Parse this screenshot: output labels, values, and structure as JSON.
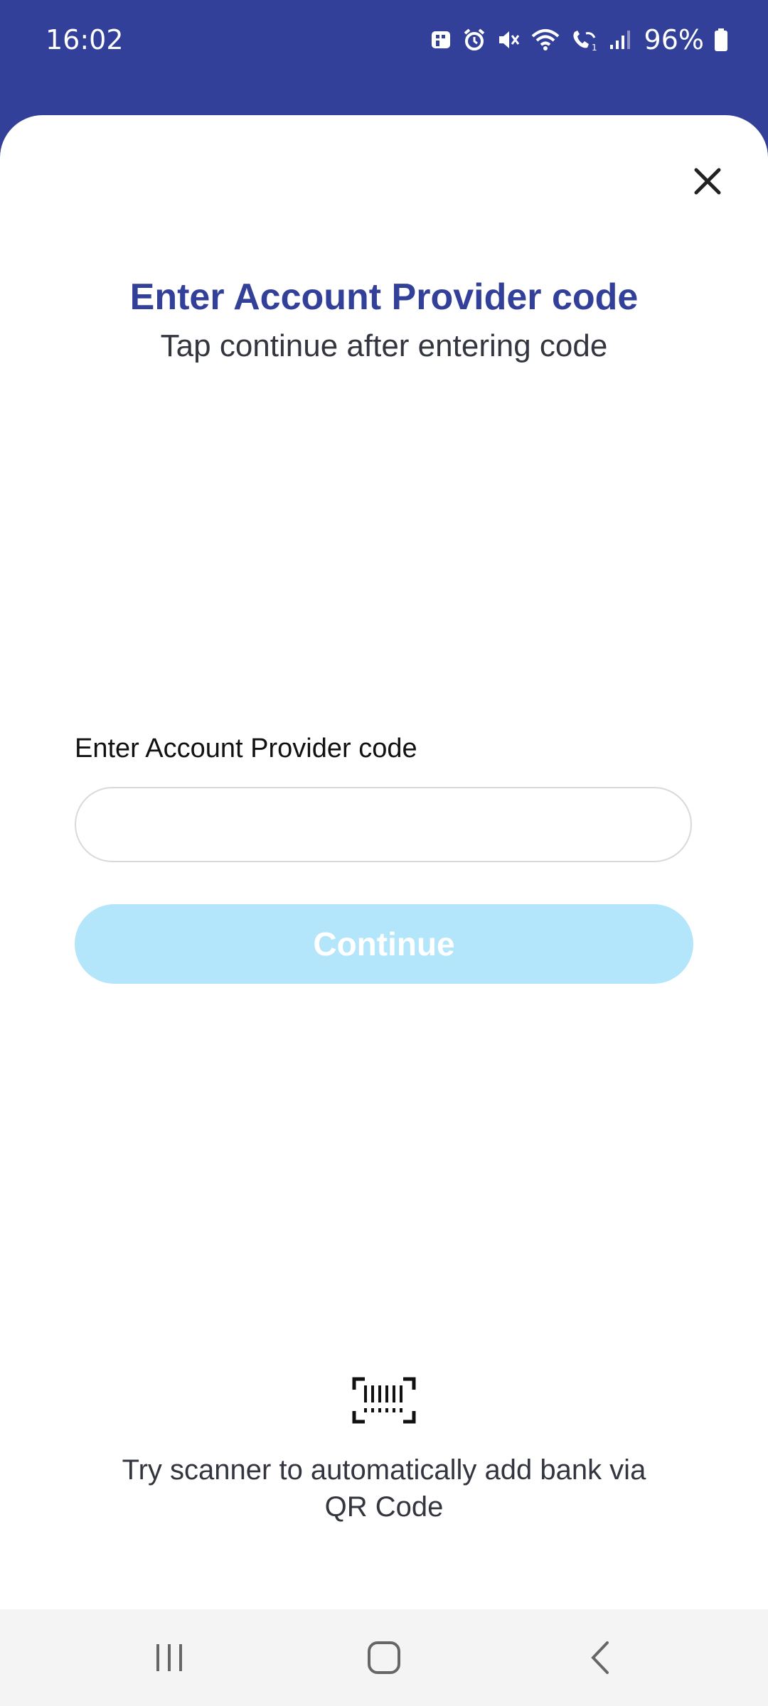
{
  "status_bar": {
    "time": "16:02",
    "battery": "96%",
    "icons": [
      "bank-notification-icon",
      "alarm-icon",
      "mute-icon",
      "wifi-icon",
      "wifi-calling-icon",
      "signal-icon",
      "battery-icon"
    ]
  },
  "colors": {
    "brand": "#33409a",
    "button_disabled": "#b3e5fb",
    "text_dark": "#33353f"
  },
  "sheet": {
    "title": "Enter Account Provider code",
    "subtitle": "Tap continue after entering code",
    "field_label": "Enter Account Provider code",
    "input_value": "",
    "input_placeholder": "",
    "continue_label": "Continue",
    "scanner_text": "Try scanner to automatically add bank via QR Code",
    "close_icon": "close-icon",
    "scanner_icon": "barcode-scanner-icon"
  },
  "navbar": {
    "icons": [
      "recent-apps-icon",
      "home-icon",
      "back-icon"
    ]
  }
}
